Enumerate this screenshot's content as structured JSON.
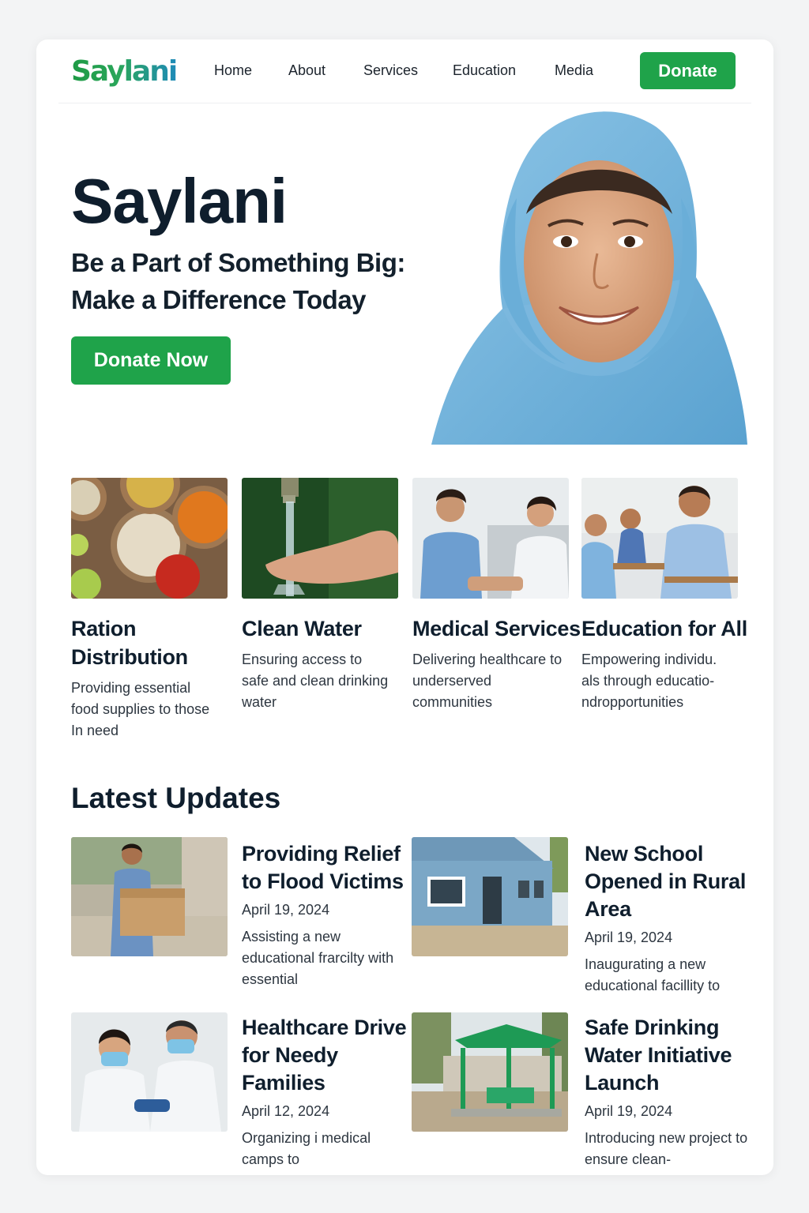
{
  "brand": {
    "logo_text": "Saylani",
    "primary_color": "#1fa34a",
    "logo_gradient": [
      "#1e9a45",
      "#1f8bb8"
    ]
  },
  "nav": {
    "items": [
      {
        "label": "Home"
      },
      {
        "label": "About"
      },
      {
        "label": "Services"
      },
      {
        "label": "Education"
      },
      {
        "label": "Media"
      }
    ],
    "donate_label": "Donate"
  },
  "hero": {
    "title": "Saylani",
    "subtitle_line1": "Be a Part of Something Big:",
    "subtitle_line2": "Make a Difference Today",
    "cta_label": "Donate Now",
    "image": "girl-in-blue-hijab-photo"
  },
  "services": [
    {
      "title_line1": "Ration",
      "title_line2": "Distribution",
      "description": "Providing essential food supplies to those In need",
      "image": "grains-and-apples-photo"
    },
    {
      "title_line1": "Clean Water",
      "title_line2": "",
      "description": "Ensuring access to safe and clean drinking water",
      "image": "hands-under-tap-photo"
    },
    {
      "title_line1": "Medical Services",
      "title_line2": "",
      "description": "Delivering healthcare to underserved communities",
      "image": "nurse-and-patient-photo"
    },
    {
      "title_line1": "Education for All",
      "title_line2": "",
      "description": "Empowering individu. als through educatio- ndropportunities",
      "image": "teacher-and-students-photo"
    }
  ],
  "updates": {
    "heading": "Latest Updates",
    "items": [
      {
        "title": "Providing Relief to Flood Victims",
        "date": "April 19, 2024",
        "description": "Assisting a new educational frarcilty with essential",
        "image": "boy-carrying-box-photo"
      },
      {
        "title": "New School Opened in Rural Area",
        "date": "April 19, 2024",
        "description": "Inaugurating a new educational facillity to",
        "image": "blue-school-building-photo"
      },
      {
        "title": "Healthcare Drive for Needy Families",
        "date": "April 12, 2024",
        "description": "Organizing  i medical camps to",
        "image": "masked-doctors-photo"
      },
      {
        "title": "Safe Drinking Water Initiative Launch",
        "date": "April 19, 2024",
        "description": "Introducing new project to ensure clean-",
        "image": "green-water-shelter-photo"
      }
    ]
  }
}
